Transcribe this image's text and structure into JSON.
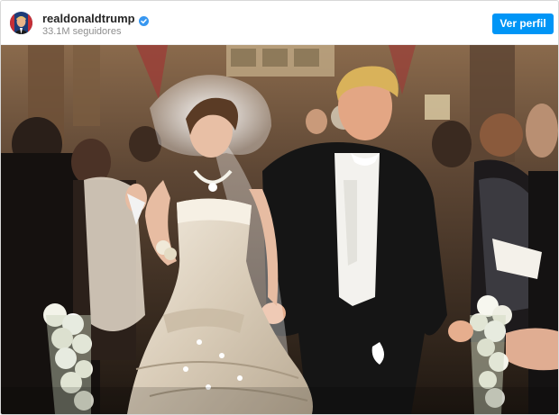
{
  "header": {
    "username": "realdonaldtrump",
    "followers": "33.1M seguidores",
    "profile_button_label": "Ver perfil",
    "verified_badge": "verified-check-icon",
    "avatar": "profile-avatar"
  },
  "post": {
    "photo": "wedding-photo",
    "colors": {
      "badge_blue": "#3897f0",
      "button_blue": "#0095f6",
      "gown": "#e8dfd0",
      "tuxedo": "#151515"
    }
  }
}
